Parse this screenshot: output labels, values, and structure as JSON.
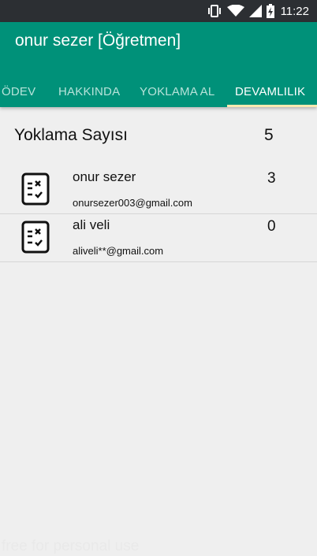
{
  "status_bar": {
    "time": "11:22",
    "icons": [
      "vibrate-icon",
      "wifi-icon",
      "signal-icon",
      "battery-charging-icon"
    ]
  },
  "app_bar": {
    "title": "onur sezer [Öğretmen]",
    "background_color": "#009179",
    "tabs": [
      {
        "label": "ÖDEV",
        "active": false
      },
      {
        "label": "HAKKINDA",
        "active": false
      },
      {
        "label": "YOKLAMA AL",
        "active": false
      },
      {
        "label": "DEVAMLILIK",
        "active": true
      }
    ],
    "indicator_color": "#f8e9b0"
  },
  "attendance": {
    "header_label": "Yoklama Sayısı",
    "header_count": "5",
    "rows": [
      {
        "name": "onur sezer",
        "email": "onursezer003@gmail.com",
        "count": "3",
        "icon": "attendance-list-icon"
      },
      {
        "name": "ali veli",
        "email": "aliveli**@gmail.com",
        "count": "0",
        "icon": "attendance-list-icon"
      }
    ]
  },
  "watermark": "free for personal use"
}
